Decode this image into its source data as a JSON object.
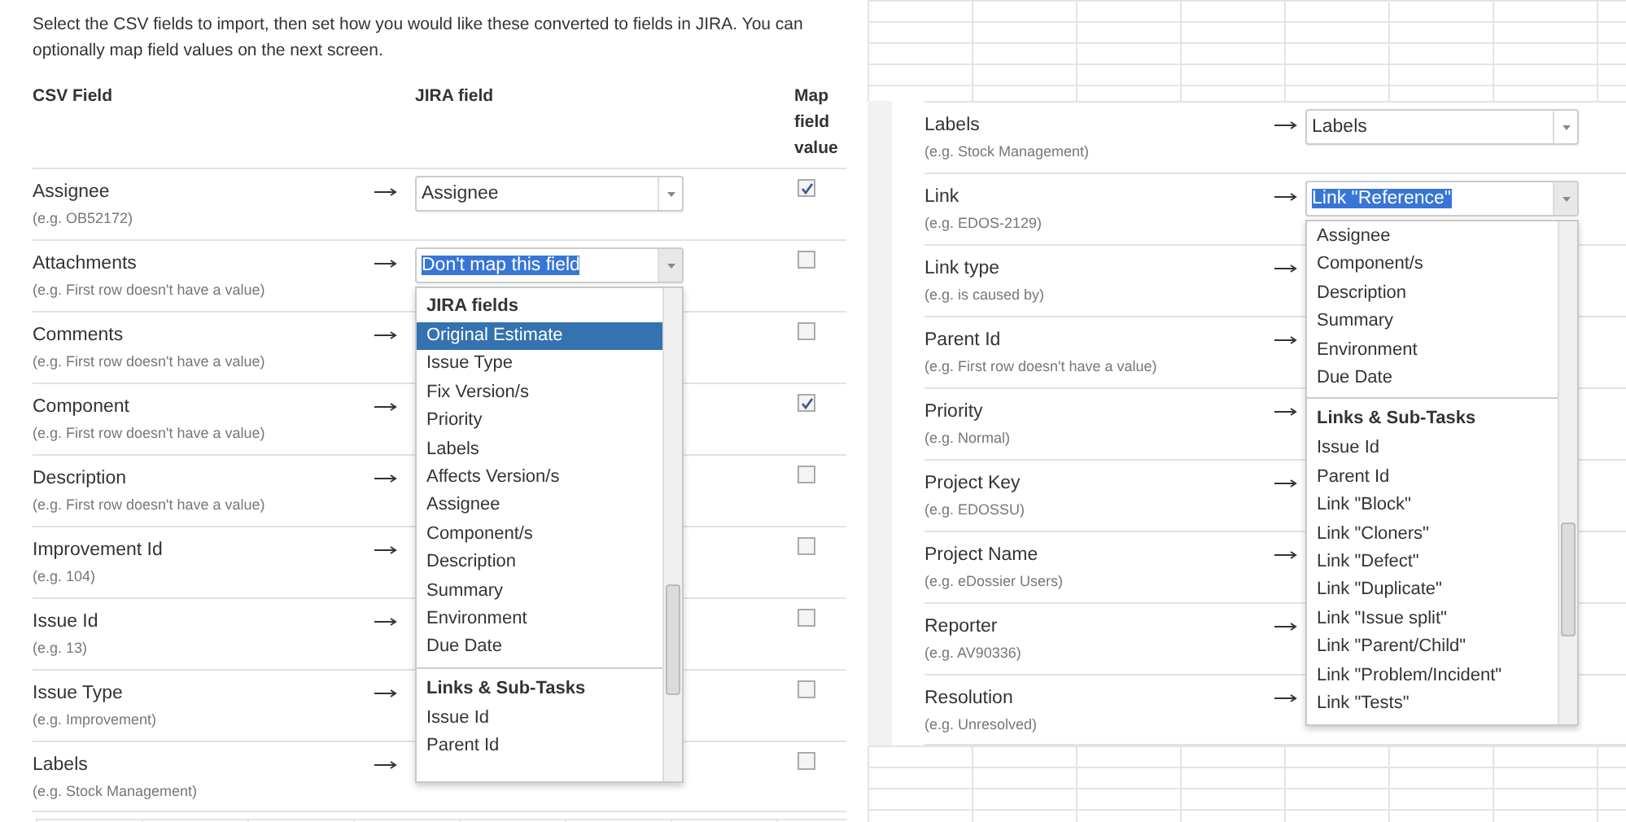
{
  "panels": [
    {
      "intro": "Select the CSV fields to import, then set how you would like these converted to fields in JIRA. You can optionally map field values on the next screen.",
      "columns": [
        "CSV Field",
        "JIRA field",
        "Map field value"
      ],
      "rows": [
        {
          "name": "Assignee",
          "example": "(e.g. OB52172)",
          "checked": true,
          "mapping": {
            "value": "Assignee",
            "focused": false
          }
        },
        {
          "name": "Attachments",
          "example": "(e.g. First row doesn't have a value)",
          "checked": false,
          "mapping": {
            "value": "Don't map this field",
            "focused": true,
            "options": [
              {
                "group": "JIRA fields",
                "items": [
                  {
                    "label": "Original Estimate",
                    "selected": true
                  },
                  {
                    "label": "Issue Type",
                    "selected": false
                  },
                  {
                    "label": "Fix Version/s",
                    "selected": false
                  },
                  {
                    "label": "Priority",
                    "selected": false
                  },
                  {
                    "label": "Labels",
                    "selected": false
                  },
                  {
                    "label": "Affects Version/s",
                    "selected": false
                  },
                  {
                    "label": "Assignee",
                    "selected": false
                  },
                  {
                    "label": "Component/s",
                    "selected": false
                  },
                  {
                    "label": "Description",
                    "selected": false
                  },
                  {
                    "label": "Summary",
                    "selected": false
                  },
                  {
                    "label": "Environment",
                    "selected": false
                  },
                  {
                    "label": "Due Date",
                    "selected": false
                  }
                ]
              },
              {
                "group": "Links & Sub-Tasks",
                "items": [
                  {
                    "label": "Issue Id",
                    "selected": false
                  },
                  {
                    "label": "Parent Id",
                    "selected": false
                  }
                ]
              }
            ]
          }
        },
        {
          "name": "Comments",
          "example": "(e.g. First row doesn't have a value)",
          "checked": false
        },
        {
          "name": "Component",
          "example": "(e.g. First row doesn't have a value)",
          "checked": true
        },
        {
          "name": "Description",
          "example": "(e.g. First row doesn't have a value)",
          "checked": false
        },
        {
          "name": "Improvement Id",
          "example": "(e.g. 104)",
          "checked": false
        },
        {
          "name": "Issue Id",
          "example": "(e.g. 13)",
          "checked": false
        },
        {
          "name": "Issue Type",
          "example": "(e.g. Improvement)",
          "checked": false
        },
        {
          "name": "Labels",
          "example": "(e.g. Stock Management)",
          "checked": false
        }
      ]
    },
    {
      "rows": [
        {
          "name": "Labels",
          "example": "(e.g. Stock Management)",
          "mapping": {
            "value": "Labels",
            "focused": false
          }
        },
        {
          "name": "Link",
          "example": "(e.g. EDOS-2129)",
          "mapping": {
            "value": "Link \"Reference\"",
            "focused": true,
            "options": [
              {
                "items": [
                  {
                    "label": "Assignee",
                    "selected": false
                  },
                  {
                    "label": "Component/s",
                    "selected": false
                  },
                  {
                    "label": "Description",
                    "selected": false
                  },
                  {
                    "label": "Summary",
                    "selected": false
                  },
                  {
                    "label": "Environment",
                    "selected": false
                  },
                  {
                    "label": "Due Date",
                    "selected": false
                  }
                ]
              },
              {
                "group": "Links & Sub-Tasks",
                "items": [
                  {
                    "label": "Issue Id",
                    "selected": false
                  },
                  {
                    "label": "Parent Id",
                    "selected": false
                  },
                  {
                    "label": "Link \"Block\"",
                    "selected": false
                  },
                  {
                    "label": "Link \"Cloners\"",
                    "selected": false
                  },
                  {
                    "label": "Link \"Defect\"",
                    "selected": false
                  },
                  {
                    "label": "Link \"Duplicate\"",
                    "selected": false
                  },
                  {
                    "label": "Link \"Issue split\"",
                    "selected": false
                  },
                  {
                    "label": "Link \"Parent/Child\"",
                    "selected": false
                  },
                  {
                    "label": "Link \"Problem/Incident\"",
                    "selected": false
                  },
                  {
                    "label": "Link \"Tests\"",
                    "selected": false
                  }
                ]
              }
            ]
          }
        },
        {
          "name": "Link type",
          "example": "(e.g. is caused by)"
        },
        {
          "name": "Parent Id",
          "example": "(e.g. First row doesn't have a value)"
        },
        {
          "name": "Priority",
          "example": "(e.g. Normal)"
        },
        {
          "name": "Project Key",
          "example": "(e.g. EDOSSU)"
        },
        {
          "name": "Project Name",
          "example": "(e.g. eDossier Users)"
        },
        {
          "name": "Reporter",
          "example": "(e.g. AV90336)"
        },
        {
          "name": "Resolution",
          "example": "(e.g. Unresolved)"
        }
      ]
    }
  ]
}
